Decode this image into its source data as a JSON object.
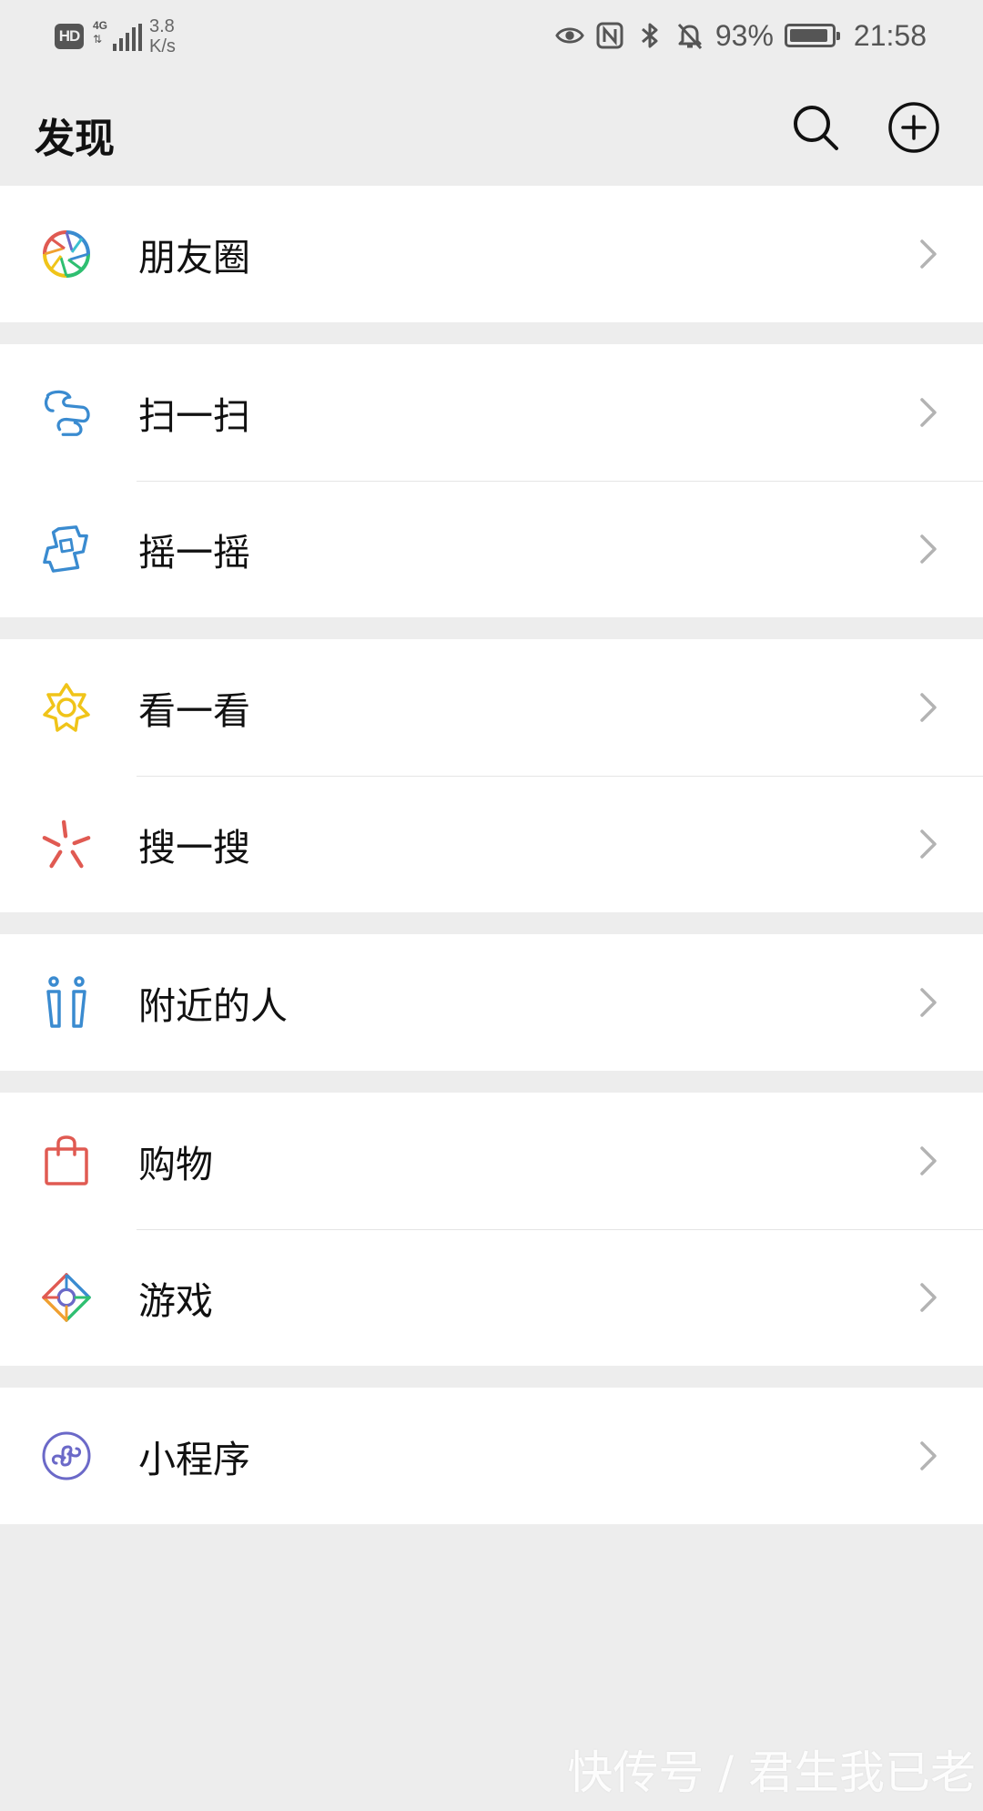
{
  "status_bar": {
    "hd": "HD",
    "network_type": "4G",
    "speed_value": "3.8",
    "speed_unit": "K/s",
    "battery_percent": "93%",
    "time": "21:58",
    "icons": [
      "eye-icon",
      "nfc-icon",
      "bluetooth-icon",
      "bell-off-icon",
      "battery-icon"
    ]
  },
  "header": {
    "title": "发现",
    "search_icon": "search-icon",
    "add_icon": "add-circle-icon"
  },
  "groups": [
    {
      "items": [
        {
          "label": "朋友圈",
          "icon": "moments-icon",
          "icon_color": "multicolor"
        }
      ]
    },
    {
      "items": [
        {
          "label": "扫一扫",
          "icon": "scan-icon",
          "icon_color": "#3a8bd0"
        },
        {
          "label": "摇一摇",
          "icon": "shake-icon",
          "icon_color": "#3a8bd0"
        }
      ]
    },
    {
      "items": [
        {
          "label": "看一看",
          "icon": "top-stories-icon",
          "icon_color": "#f0c419"
        },
        {
          "label": "搜一搜",
          "icon": "search-spark-icon",
          "icon_color": "#e05a52"
        }
      ]
    },
    {
      "items": [
        {
          "label": "附近的人",
          "icon": "people-nearby-icon",
          "icon_color": "#3a8bd0"
        }
      ]
    },
    {
      "items": [
        {
          "label": "购物",
          "icon": "shopping-bag-icon",
          "icon_color": "#e05a52"
        },
        {
          "label": "游戏",
          "icon": "games-icon",
          "icon_color": "multicolor"
        }
      ]
    },
    {
      "items": [
        {
          "label": "小程序",
          "icon": "mini-program-icon",
          "icon_color": "#6b69c8"
        }
      ]
    }
  ],
  "watermark": "快传号 / 君生我已老",
  "colors": {
    "background": "#ededed",
    "card": "#ffffff",
    "divider": "#e5e5e5",
    "chevron": "#b3b3b3",
    "text": "#111111"
  }
}
